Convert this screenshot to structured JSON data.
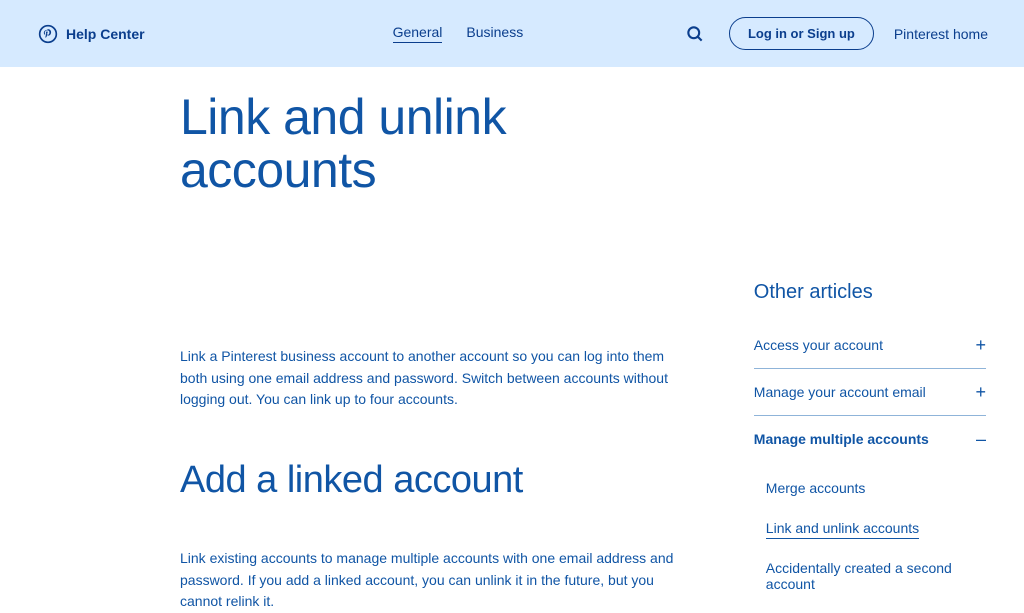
{
  "header": {
    "brand": "Help Center",
    "tabs": {
      "general": "General",
      "business": "Business"
    },
    "login": "Log in or Sign up",
    "pinterest_home": "Pinterest home"
  },
  "page": {
    "title": "Link and unlink accounts",
    "intro": "Link a Pinterest business account to another account so you can log into them both using one email address and password. Switch between accounts without logging out. You can link up to four accounts.",
    "section_heading": "Add a linked account",
    "section_body": "Link existing accounts to manage multiple accounts with one email address and password. If you add a linked account, you can unlink it in the future, but you cannot relink it."
  },
  "sidebar": {
    "title": "Other articles",
    "items": [
      {
        "label": "Access your account",
        "expanded": false
      },
      {
        "label": "Manage your account email",
        "expanded": false
      },
      {
        "label": "Manage multiple accounts",
        "expanded": true
      }
    ],
    "sublist": [
      {
        "label": "Merge accounts",
        "current": false
      },
      {
        "label": "Link and unlink accounts",
        "current": true
      },
      {
        "label": "Accidentally created a second account",
        "current": false
      }
    ]
  }
}
